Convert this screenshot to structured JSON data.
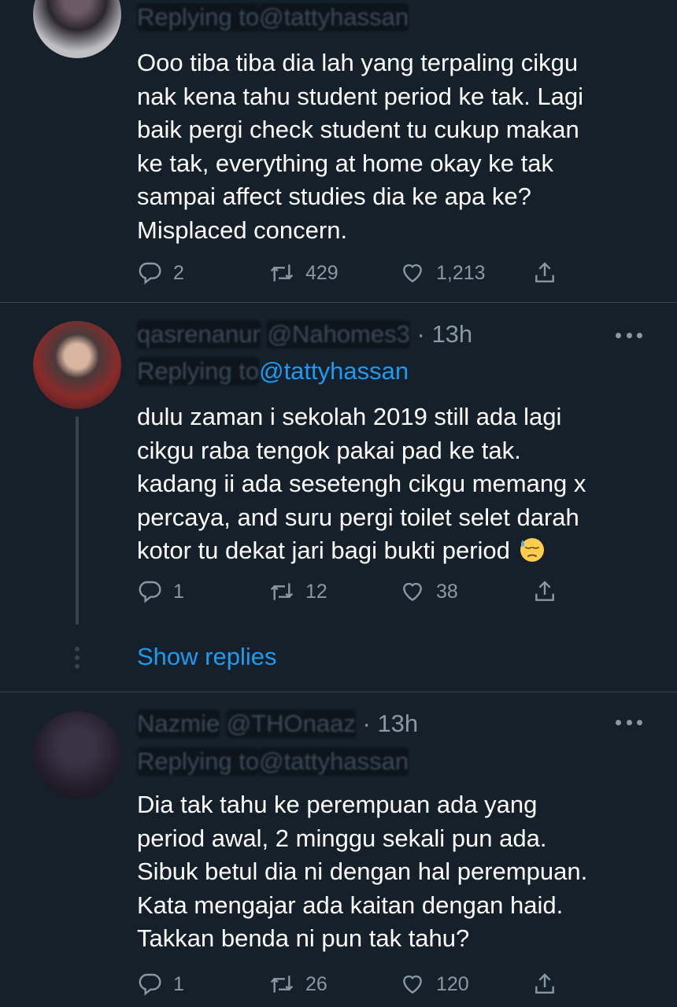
{
  "tweets": [
    {
      "reply_prefix": "Replying to ",
      "reply_to": "@tattyhassan",
      "body": "Ooo tiba tiba dia lah yang terpaling cikgu\nnak kena tahu student period ke tak. Lagi\nbaik pergi check student tu cukup makan\nke tak, everything at home okay ke tak\nsampai affect studies dia ke apa ke?\nMisplaced concern.",
      "replies": "2",
      "retweets": "429",
      "likes": "1,213"
    },
    {
      "name": "qasrenanur",
      "handle": "@Nahomes3",
      "dot": "·",
      "time": "13h",
      "reply_prefix": "Replying to ",
      "reply_to": "@tattyhassan",
      "body": "dulu zaman i sekolah 2019 still ada lagi\ncikgu raba tengok pakai pad ke tak.\nkadang ii ada sesetengh cikgu memang x\npercaya, and suru pergi toilet selet darah\nkotor tu dekat jari bagi bukti period",
      "emoji": "downcast-face-with-sweat-emoji",
      "replies": "1",
      "retweets": "12",
      "likes": "38",
      "show_replies": "Show replies"
    },
    {
      "name": "Nazmie",
      "handle": "@THOnaaz",
      "dot": "·",
      "time": "13h",
      "reply_prefix": "Replying to ",
      "reply_to": "@tattyhassan",
      "body": "Dia tak tahu ke perempuan ada yang\nperiod awal, 2 minggu sekali pun ada.\nSibuk betul dia ni dengan hal perempuan.\nKata mengajar ada kaitan dengan haid.\nTakkan benda ni pun tak tahu?",
      "replies": "1",
      "retweets": "26",
      "likes": "120"
    }
  ],
  "colors": {
    "background": "#15202b",
    "secondary_text": "#8899a6",
    "link": "#1d9bf0",
    "divider": "#38444d"
  },
  "icons": [
    "reply-icon",
    "retweet-icon",
    "like-icon",
    "share-icon",
    "more-icon"
  ]
}
